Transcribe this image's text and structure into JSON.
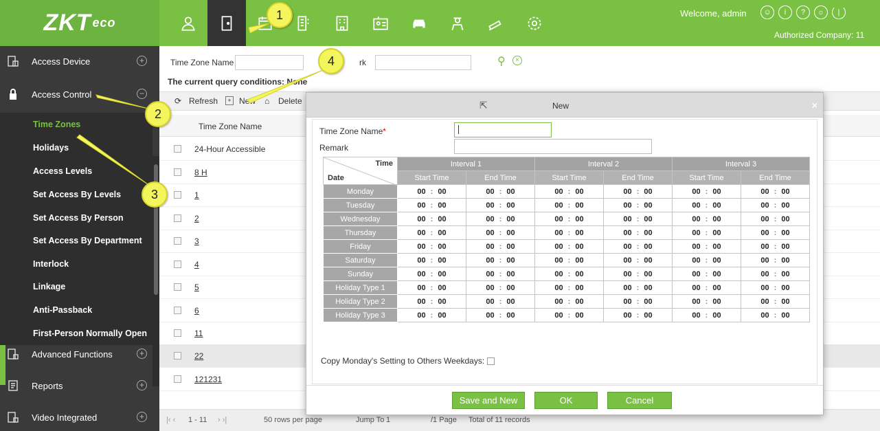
{
  "brand": {
    "logo_main": "ZKT",
    "logo_suffix": "eco"
  },
  "header": {
    "welcome": "Welcome, admin",
    "company": "Authorized Company: 11",
    "nav_icons": [
      "person-icon",
      "door-icon",
      "calendar-icon",
      "id-card-icon",
      "building-icon",
      "badge-icon",
      "car-icon",
      "guard-icon",
      "camera-icon",
      "gear-icon"
    ],
    "top_icons": [
      "user-circle-icon",
      "info-icon",
      "help-icon",
      "settings-circle-icon",
      "power-icon"
    ]
  },
  "sidebar": {
    "sections": [
      {
        "label": "Access Device",
        "icon": "device-icon",
        "toggle": "+"
      },
      {
        "label": "Access Control",
        "icon": "lock-icon",
        "toggle": "−"
      },
      {
        "label": "Advanced Functions",
        "icon": "advanced-icon",
        "toggle": "+"
      },
      {
        "label": "Reports",
        "icon": "reports-icon",
        "toggle": "+"
      },
      {
        "label": "Video Integrated",
        "icon": "video-icon",
        "toggle": "+"
      }
    ],
    "items": [
      "Time Zones",
      "Holidays",
      "Access Levels",
      "Set Access By Levels",
      "Set Access By Person",
      "Set Access By Department",
      "Interlock",
      "Linkage",
      "Anti-Passback",
      "First-Person Normally Open"
    ],
    "active_item": "Time Zones"
  },
  "search": {
    "name_label": "Time Zone Name",
    "remark_label": "Remark",
    "remark_visible": "rk"
  },
  "query": {
    "label": "The current query conditions:",
    "value": "None"
  },
  "toolbar": {
    "refresh": "Refresh",
    "new": "New",
    "delete": "Delete"
  },
  "grid": {
    "header": "Time Zone Name",
    "rows": [
      "24-Hour Accessible",
      "8 H",
      "1",
      "2",
      "3",
      "4",
      "5",
      "6",
      "11",
      "22",
      "121231"
    ],
    "highlighted_row": "22"
  },
  "pager": {
    "range": "1 - 11",
    "rows_per_page": "50 rows per page",
    "jump": "Jump To",
    "page": "1",
    "page_unit": "/1 Page",
    "total": "Total of 11 records"
  },
  "modal": {
    "title": "New",
    "close": "×",
    "name_label": "Time Zone Name",
    "required_mark": "*",
    "remark_label": "Remark",
    "corner_time": "Time",
    "corner_date": "Date",
    "intervals": [
      "Interval 1",
      "Interval 2",
      "Interval 3"
    ],
    "start_label": "Start Time",
    "end_label": "End Time",
    "days": [
      "Monday",
      "Tuesday",
      "Wednesday",
      "Thursday",
      "Friday",
      "Saturday",
      "Sunday",
      "Holiday Type 1",
      "Holiday Type 2",
      "Holiday Type 3"
    ],
    "time_hh": "00",
    "time_mm": "00",
    "copy_label": "Copy Monday's Setting to Others Weekdays:",
    "buttons": {
      "save_new": "Save and New",
      "ok": "OK",
      "cancel": "Cancel"
    }
  },
  "callouts": [
    "1",
    "2",
    "3",
    "4"
  ],
  "colors": {
    "brand_green": "#7ac143",
    "sidebar_dark": "#3a3a3a",
    "callout_yellow": "#f4f45c"
  }
}
